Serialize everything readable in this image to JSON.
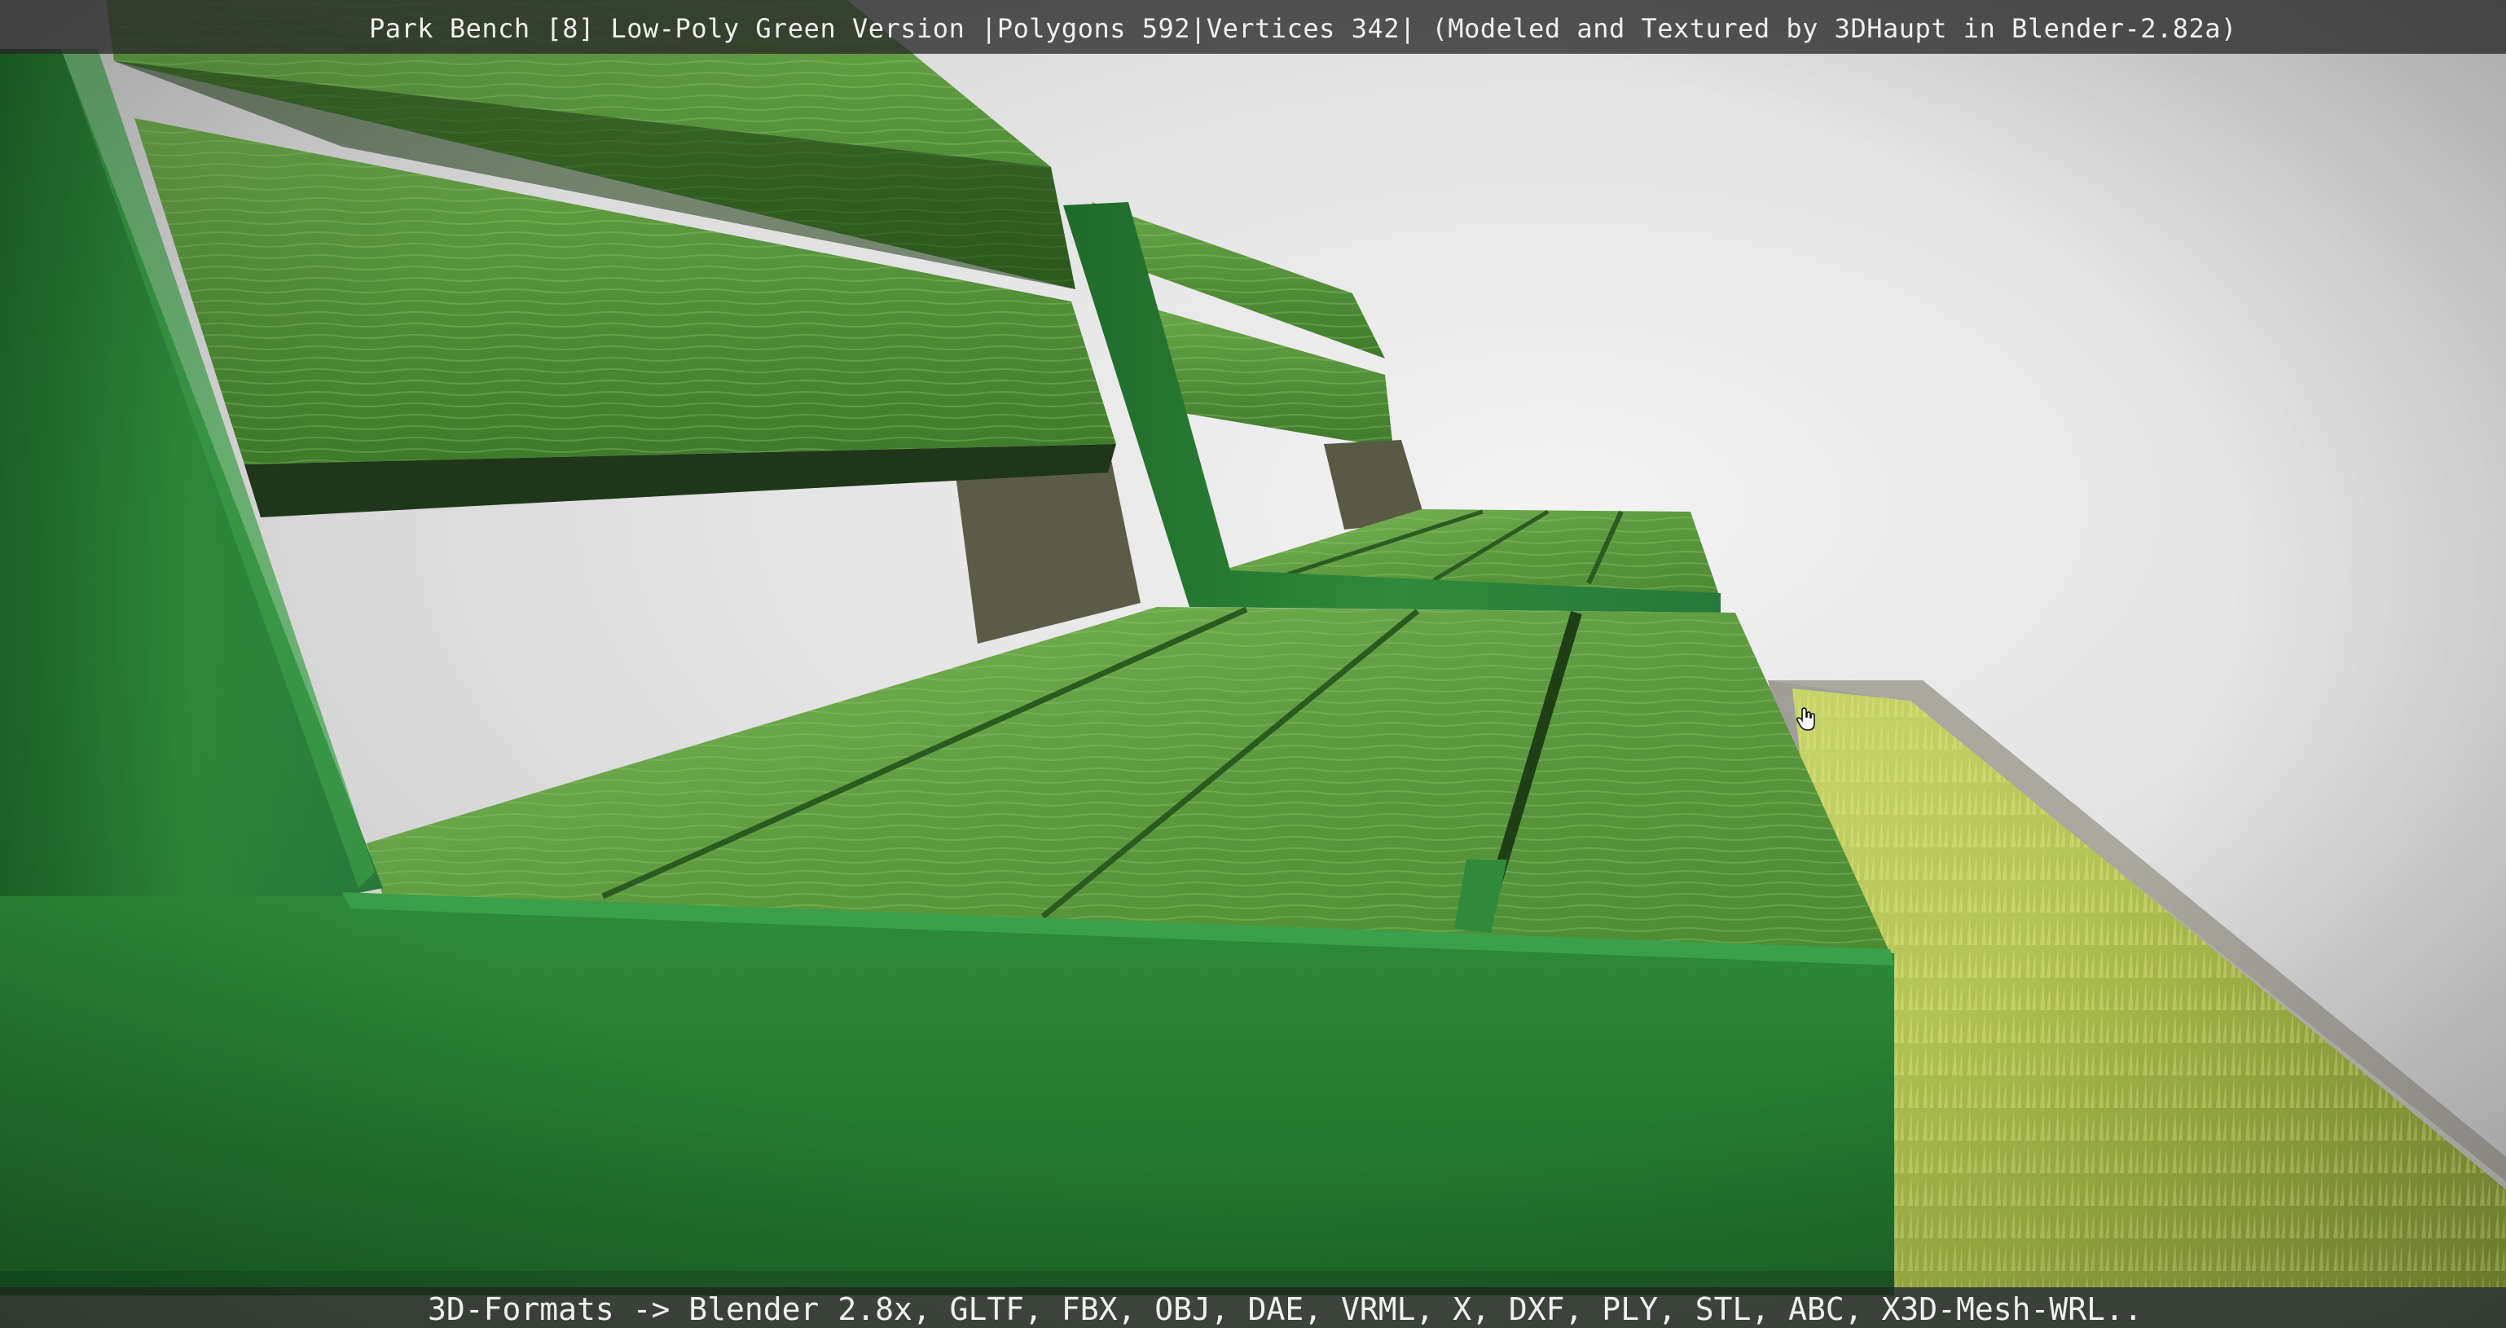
{
  "viewer": {
    "title": "Park Bench [8] Low-Poly Green Version |Polygons 592|Vertices 342| (Modeled and Textured by 3DHaupt in Blender-2.82a)",
    "formats": "3D-Formats -> Blender 2.8x, GLTF, FBX, OBJ, DAE, VRML, X, DXF, PLY, STL, ABC, X3D-Mesh-WRL..",
    "cursor_icon": "hand-cursor-icon"
  },
  "colors": {
    "background": "#e2e2e2",
    "frame_green": "#2f8a3c",
    "frame_green_dark": "#1f6a2a",
    "wood_green": "#5d9a40",
    "wood_green_light": "#7fb85a",
    "grass": "#b5c85a",
    "planter_concrete": "#b9b9b0",
    "overlay_bar": "#282828",
    "overlay_text": "#f0f0f0"
  }
}
